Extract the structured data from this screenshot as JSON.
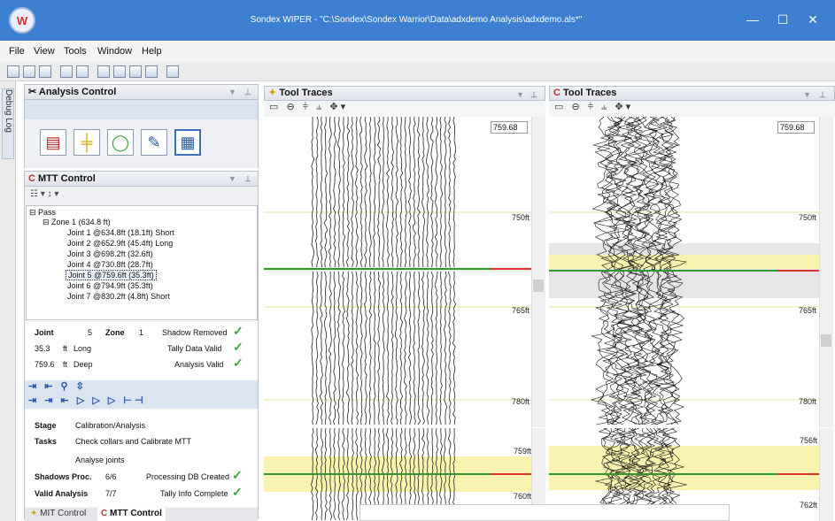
{
  "app": {
    "title": "Sondex WIPER - \"C:\\Sondex\\Sondex Warrior\\Data\\adxdemo Analysis\\adxdemo.als*\"",
    "window_controls": [
      "—",
      "☐",
      "✕"
    ]
  },
  "menu": [
    "File",
    "View",
    "Tools",
    "Window",
    "Help"
  ],
  "debug_tab": "Debug Log",
  "analysis_control": {
    "title": "Analysis Control"
  },
  "mtt_control": {
    "title": "MTT Control",
    "tools": "☷ ▾   ↕ ▾",
    "tree": {
      "pass": "Pass",
      "zone": "Zone 1 (634.8 ft)",
      "joints": [
        "Joint 1 @634.8ft (18.1ft) Short",
        "Joint 2 @652.9ft (45.4ft) Long",
        "Joint 3 @698.2ft (32.6ft)",
        "Joint 4 @730.8ft (28.7ft)",
        "Joint 5 @759.6ft (35.3ft)",
        "Joint 6 @794.9ft (35.3ft)",
        "Joint 7 @830.2ft (4.8ft) Short"
      ]
    },
    "stats": {
      "joint_label": "Joint",
      "joint_value": "5",
      "zone_label": "Zone",
      "zone_value": "1",
      "shadow": "Shadow Removed",
      "length": "35.3",
      "length_unit": "ft",
      "length_label": "Long",
      "tally": "Tally Data Valid",
      "depth": "759.6",
      "depth_unit": "ft",
      "depth_label": "Deep",
      "analysis": "Analysis Valid"
    },
    "stage": {
      "stage_label": "Stage",
      "stage_value": "Calibration/Analysis",
      "tasks_label": "Tasks",
      "task1": "Check collars and Calibrate MTT",
      "task2": "Analyse joints",
      "shadows_label": "Shadows Proc.",
      "shadows_value": "6/6",
      "shadows_status": "Processing DB Created",
      "valid_label": "Valid Analysis",
      "valid_value": "7/7",
      "valid_status": "Tally Info Complete"
    },
    "bottom_tabs": [
      "MIT Control",
      "MTT Control"
    ]
  },
  "trace_left": {
    "title": "Tool Traces",
    "depth_box": "759.68",
    "depths": [
      "750ft",
      "765ft",
      "780ft"
    ],
    "lower_depths": [
      "759ft",
      "760ft"
    ]
  },
  "trace_right": {
    "title": "Tool Traces",
    "depth_box": "759.68",
    "depths": [
      "750ft",
      "765ft",
      "780ft"
    ],
    "lower_depths": [
      "756ft",
      "762ft"
    ]
  }
}
